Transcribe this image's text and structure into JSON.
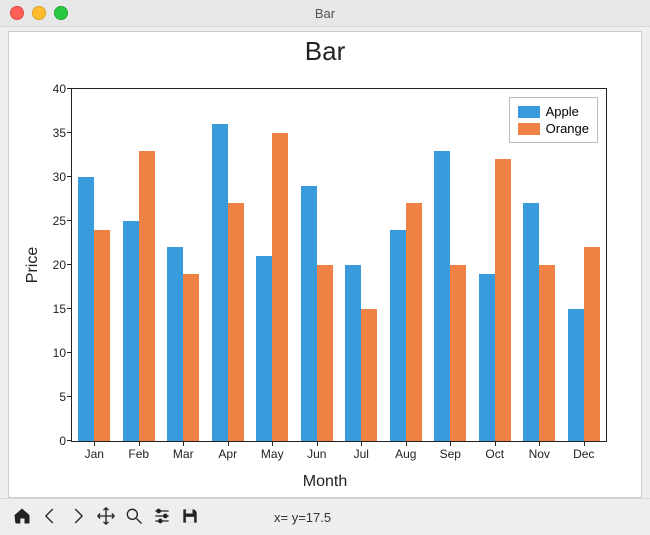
{
  "window": {
    "title": "Bar"
  },
  "chart_data": {
    "type": "bar",
    "title": "Bar",
    "xlabel": "Month",
    "ylabel": "Price",
    "categories": [
      "Jan",
      "Feb",
      "Mar",
      "Apr",
      "May",
      "Jun",
      "Jul",
      "Aug",
      "Sep",
      "Oct",
      "Nov",
      "Dec"
    ],
    "series": [
      {
        "name": "Apple",
        "color": "#3a9bdc",
        "values": [
          30,
          25,
          22,
          36,
          21,
          29,
          20,
          24,
          33,
          19,
          27,
          15
        ]
      },
      {
        "name": "Orange",
        "color": "#ee8245",
        "values": [
          24,
          33,
          19,
          27,
          35,
          20,
          15,
          27,
          20,
          32,
          20,
          22
        ]
      }
    ],
    "yticks": [
      0,
      5,
      10,
      15,
      20,
      25,
      30,
      35,
      40
    ],
    "ylim": [
      0,
      40
    ],
    "legend_position": "upper right"
  },
  "toolbar": {
    "buttons": [
      {
        "name": "home-button",
        "icon": "home-icon"
      },
      {
        "name": "back-button",
        "icon": "back-icon"
      },
      {
        "name": "forward-button",
        "icon": "forward-icon"
      },
      {
        "name": "pan-button",
        "icon": "move-icon"
      },
      {
        "name": "zoom-button",
        "icon": "zoom-icon"
      },
      {
        "name": "configure-button",
        "icon": "sliders-icon"
      },
      {
        "name": "save-button",
        "icon": "save-icon"
      }
    ],
    "status": "x= y=17.5"
  }
}
